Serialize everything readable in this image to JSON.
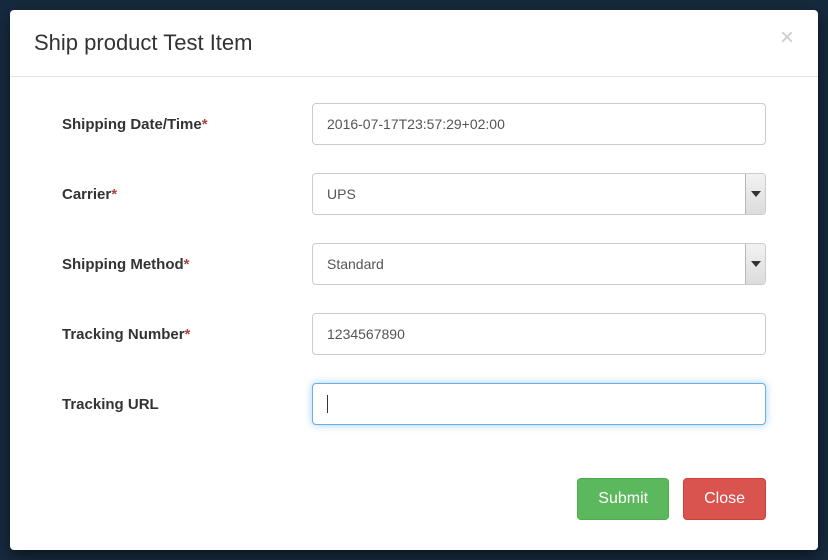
{
  "modal": {
    "title": "Ship product Test Item"
  },
  "form": {
    "shipping_date": {
      "label": "Shipping Date/Time",
      "required": "*",
      "value": "2016-07-17T23:57:29+02:00"
    },
    "carrier": {
      "label": "Carrier",
      "required": "*",
      "value": "UPS"
    },
    "method": {
      "label": "Shipping Method",
      "required": "*",
      "value": "Standard"
    },
    "tracking_no": {
      "label": "Tracking Number",
      "required": "*",
      "value": "1234567890"
    },
    "tracking_url": {
      "label": "Tracking URL",
      "required": "",
      "value": ""
    }
  },
  "footer": {
    "submit": "Submit",
    "close": "Close"
  }
}
